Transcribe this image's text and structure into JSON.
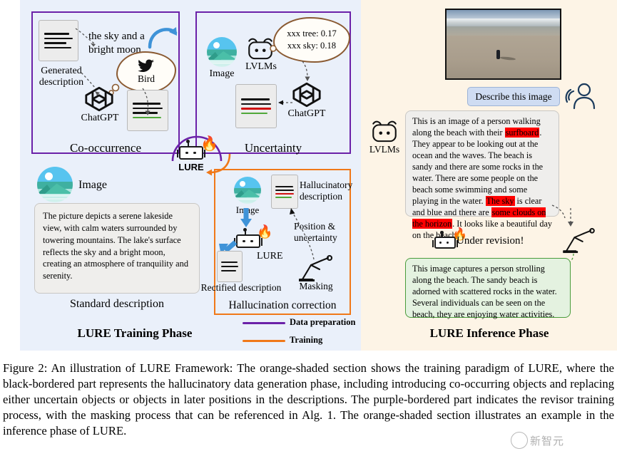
{
  "figure": {
    "number": "Figure 2:",
    "caption": "Figure 2:  An illustration of LURE Framework:  The orange-shaded section shows the training paradigm of LURE, where the black-bordered part represents the hallucinatory data generation phase, including introducing co-occurring objects and replacing either uncertain objects or objects in later positions in the descriptions. The purple-bordered part indicates the revisor training process, with the masking process that can be referenced in Alg. 1. The orange-shaded section illustrates an example in the inference phase of LURE."
  },
  "training_phase": {
    "title": "LURE Training Phase",
    "co_occurrence": {
      "box_label": "Co-occurrence",
      "generated_description_label": "Generated\ndescription",
      "phrase": "the sky and a\nbright moon",
      "cloud_word": "Bird",
      "chatgpt_label": "ChatGPT"
    },
    "uncertainty": {
      "box_label": "Uncertainty",
      "image_label": "Image",
      "lvlms_label": "LVLMs",
      "cloud_line1": "xxx tree: 0.17",
      "cloud_line2": "xxx sky: 0.18",
      "chatgpt_label": "ChatGPT"
    },
    "lure_label": "LURE",
    "standard": {
      "image_label": "Image",
      "description": "The picture depicts a serene lakeside view, with calm waters surrounded by towering mountains. The lake's surface reflects the sky and a bright moon, creating an atmosphere of tranquility and serenity.",
      "caption": "Standard description"
    },
    "hallucination_correction": {
      "box_label": "Hallucination correction",
      "image_label": "Image",
      "hallucinatory_label": "Hallucinatory\ndescription",
      "position_uncertainty_label": "Position &\nuncertainty",
      "lure_label": "LURE",
      "masking_label": "Masking",
      "rectified_label": "Rectified description"
    },
    "legend": [
      {
        "label": "Data preparation",
        "color": "#6b21a8"
      },
      {
        "label": "Training",
        "color": "#f07818"
      }
    ]
  },
  "inference_phase": {
    "title": "LURE Inference Phase",
    "describe_button": "Describe this image",
    "lvlms_label": "LVLMs",
    "lvlm_reply": {
      "parts": [
        {
          "text": "This is an image of a person walking along the beach with their "
        },
        {
          "text": "surfboard",
          "highlight": true
        },
        {
          "text": ". They appear to be looking out at the ocean and the waves. The beach is sandy and there are some rocks in the water. There are some people on the beach some swimming and some playing in the water. "
        },
        {
          "text": "The sky",
          "highlight": true
        },
        {
          "text": " is clear and blue and there are "
        },
        {
          "text": "some clouds on the horizon",
          "highlight": true
        },
        {
          "text": ". It looks like a beautiful day on the beach."
        }
      ]
    },
    "under_revision": "Under revision!",
    "revised_text": "This image captures a person strolling along the beach. The sandy beach is adorned with scattered rocks in the water. Several individuals can be seen on the beach, they are enjoying water activities."
  },
  "watermark": {
    "text": "新智元"
  },
  "colors": {
    "purple": "#6b21a8",
    "orange": "#f07818",
    "highlight_red": "#ff0000",
    "green_border": "#4a9c3c",
    "left_panel_bg": "#eaf0fa",
    "right_panel_bg": "#fdf4e6",
    "blue_arrow": "#3f93d8"
  },
  "icons": {
    "document": "document-icon",
    "chatgpt": "chatgpt-logo-icon",
    "robot": "robot-icon",
    "flame": "flame-icon",
    "lvlm": "lvlm-robot-head-icon",
    "bird": "twitter-bird-icon",
    "masking_arm": "robot-arm-icon",
    "user": "user-silhouette-icon"
  }
}
